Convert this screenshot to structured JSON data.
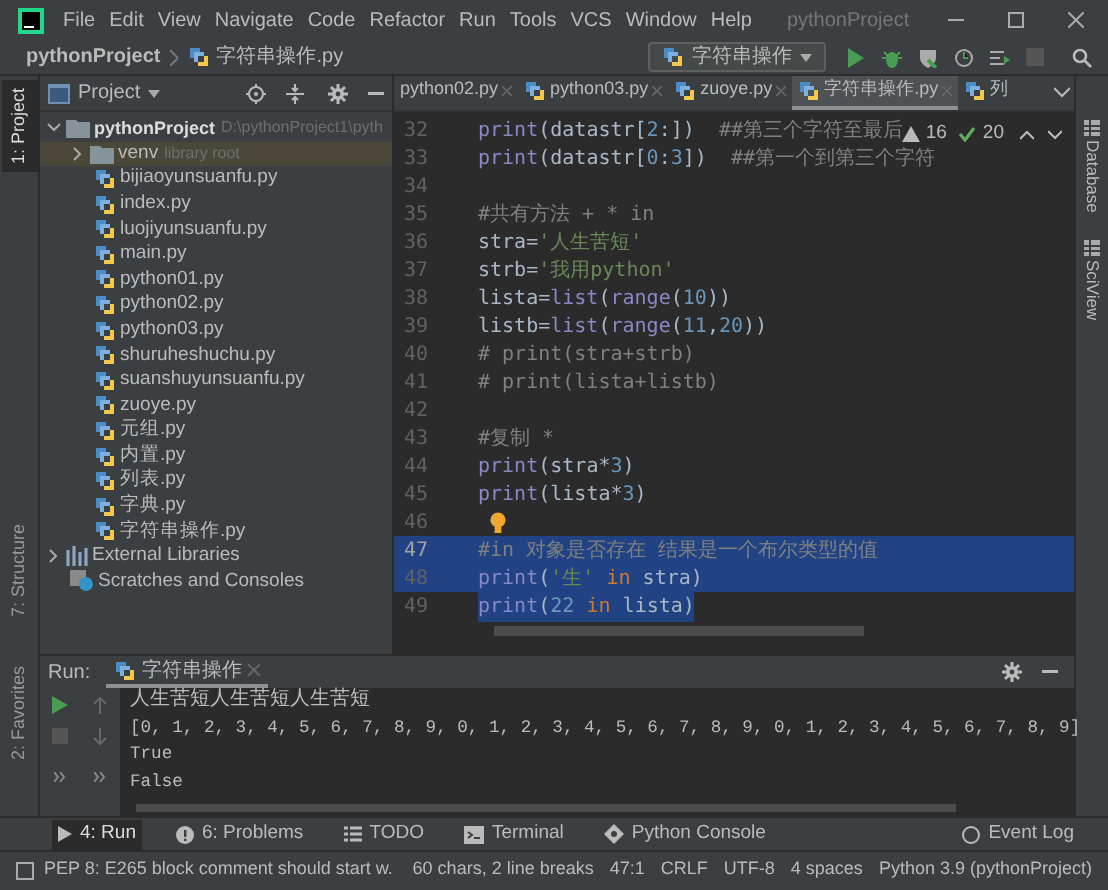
{
  "window": {
    "title": "pythonProject",
    "menu": [
      "File",
      "Edit",
      "View",
      "Navigate",
      "Code",
      "Refactor",
      "Run",
      "Tools",
      "VCS",
      "Window",
      "Help"
    ]
  },
  "breadcrumb": [
    "pythonProject",
    "字符串操作.py"
  ],
  "run_config": {
    "label": "字符串操作"
  },
  "left_stripe": [
    {
      "label": "1: Project",
      "selected": true
    },
    {
      "label": "7: Structure",
      "selected": false
    },
    {
      "label": "2: Favorites",
      "selected": false
    }
  ],
  "right_stripe": [
    "Database",
    "SciView"
  ],
  "project_panel": {
    "title": "Project",
    "tree": [
      {
        "label": "pythonProject",
        "path": "D:\\pythonProject1\\pyth",
        "kind": "folder",
        "expanded": true,
        "selected": false,
        "children": [
          {
            "label": "venv",
            "path": "library root",
            "kind": "folder",
            "expanded": false,
            "selected": true
          },
          {
            "label": "bijiaoyunsuanfu.py",
            "kind": "file",
            "selected": false
          },
          {
            "label": "index.py",
            "kind": "file",
            "selected": false
          },
          {
            "label": "luojiyunsuanfu.py",
            "kind": "file",
            "selected": false
          },
          {
            "label": "main.py",
            "kind": "file",
            "selected": false
          },
          {
            "label": "python01.py",
            "kind": "file",
            "selected": false
          },
          {
            "label": "python02.py",
            "kind": "file",
            "selected": false
          },
          {
            "label": "python03.py",
            "kind": "file",
            "selected": false
          },
          {
            "label": "shuruheshuchu.py",
            "kind": "file",
            "selected": false
          },
          {
            "label": "suanshuyunsuanfu.py",
            "kind": "file",
            "selected": false
          },
          {
            "label": "zuoye.py",
            "kind": "file",
            "selected": false
          },
          {
            "label": "元组.py",
            "kind": "file",
            "selected": false
          },
          {
            "label": "内置.py",
            "kind": "file",
            "selected": false
          },
          {
            "label": "列表.py",
            "kind": "file",
            "selected": false
          },
          {
            "label": "字典.py",
            "kind": "file",
            "selected": false
          },
          {
            "label": "字符串操作.py",
            "kind": "file",
            "selected": false
          }
        ]
      },
      {
        "label": "External Libraries",
        "kind": "libraries",
        "expanded": false,
        "selected": false
      },
      {
        "label": "Scratches and Consoles",
        "kind": "scratches",
        "selected": false
      }
    ]
  },
  "editor_tabs": [
    {
      "label": "python02.py",
      "selected": false,
      "icon": false
    },
    {
      "label": "python03.py",
      "selected": false,
      "icon": true
    },
    {
      "label": "zuoye.py",
      "selected": false,
      "icon": true
    },
    {
      "label": "字符串操作.py",
      "selected": true,
      "icon": true
    },
    {
      "label": "列",
      "selected": false,
      "icon": true
    }
  ],
  "inspections": {
    "warnings": "16",
    "ok": "20"
  },
  "editor_lines": [
    {
      "number": "32",
      "selected": false,
      "current": false,
      "tokens": [
        {
          "kind": "builtin",
          "text": "print"
        },
        {
          "kind": "plain",
          "text": "(datastr["
        },
        {
          "kind": "number",
          "text": "2"
        },
        {
          "kind": "plain",
          "text": ":])"
        },
        {
          "kind": "comment",
          "text": "##第三个字符至最后"
        }
      ]
    },
    {
      "number": "33",
      "selected": false,
      "current": false,
      "tokens": [
        {
          "kind": "builtin",
          "text": "print"
        },
        {
          "kind": "plain",
          "text": "(datastr["
        },
        {
          "kind": "number",
          "text": "0"
        },
        {
          "kind": "plain",
          "text": ":"
        },
        {
          "kind": "number",
          "text": "3"
        },
        {
          "kind": "plain",
          "text": "])"
        },
        {
          "kind": "comment",
          "text": "##第一个到第三个字符"
        }
      ]
    },
    {
      "number": "34",
      "selected": false,
      "current": false
    },
    {
      "number": "35",
      "selected": false,
      "current": false,
      "tokens": [
        {
          "kind": "comment",
          "text": "#共有方法 + * in"
        }
      ]
    },
    {
      "number": "36",
      "selected": false,
      "current": false,
      "tokens": [
        {
          "kind": "plain",
          "text": "stra="
        },
        {
          "kind": "string",
          "text": "'人生苦短'"
        }
      ]
    },
    {
      "number": "37",
      "selected": false,
      "current": false,
      "tokens": [
        {
          "kind": "plain",
          "text": "strb="
        },
        {
          "kind": "string",
          "text": "'我用python'"
        }
      ]
    },
    {
      "number": "38",
      "selected": false,
      "current": false,
      "tokens": [
        {
          "kind": "plain",
          "text": "lista="
        },
        {
          "kind": "builtin",
          "text": "list"
        },
        {
          "kind": "plain",
          "text": "("
        },
        {
          "kind": "builtin",
          "text": "range"
        },
        {
          "kind": "plain",
          "text": "("
        },
        {
          "kind": "number",
          "text": "10"
        },
        {
          "kind": "plain",
          "text": "))"
        }
      ]
    },
    {
      "number": "39",
      "selected": false,
      "current": false,
      "tokens": [
        {
          "kind": "plain",
          "text": "listb="
        },
        {
          "kind": "builtin",
          "text": "list"
        },
        {
          "kind": "plain",
          "text": "("
        },
        {
          "kind": "builtin",
          "text": "range"
        },
        {
          "kind": "plain",
          "text": "("
        },
        {
          "kind": "number",
          "text": "11"
        },
        {
          "kind": "plain",
          "text": ","
        },
        {
          "kind": "number",
          "text": "20"
        },
        {
          "kind": "plain",
          "text": "))"
        }
      ]
    },
    {
      "number": "40",
      "selected": false,
      "current": false,
      "tokens": [
        {
          "kind": "comment",
          "text": "# print(stra+strb)"
        }
      ]
    },
    {
      "number": "41",
      "selected": false,
      "current": false,
      "tokens": [
        {
          "kind": "comment",
          "text": "# print(lista+listb)"
        }
      ]
    },
    {
      "number": "42",
      "selected": false,
      "current": false
    },
    {
      "number": "43",
      "selected": false,
      "current": false,
      "tokens": [
        {
          "kind": "comment",
          "text": "#复制 *"
        }
      ]
    },
    {
      "number": "44",
      "selected": false,
      "current": false,
      "tokens": [
        {
          "kind": "builtin",
          "text": "print"
        },
        {
          "kind": "plain",
          "text": "(stra*"
        },
        {
          "kind": "number",
          "text": "3"
        },
        {
          "kind": "plain",
          "text": ")"
        }
      ]
    },
    {
      "number": "45",
      "selected": false,
      "current": false,
      "tokens": [
        {
          "kind": "builtin",
          "text": "print"
        },
        {
          "kind": "plain",
          "text": "(lista*"
        },
        {
          "kind": "number",
          "text": "3"
        },
        {
          "kind": "plain",
          "text": ")"
        }
      ]
    },
    {
      "number": "46",
      "selected": false,
      "current": false,
      "bulb": true
    },
    {
      "number": "47",
      "selected": true,
      "current": true,
      "tokens": [
        {
          "kind": "comment",
          "text": "#in 对象是否存在 结果是一个布尔类型的值"
        }
      ]
    },
    {
      "number": "48",
      "selected": true,
      "current": false,
      "tokens": [
        {
          "kind": "builtin",
          "text": "print"
        },
        {
          "kind": "plain",
          "text": "("
        },
        {
          "kind": "string",
          "text": "'生'"
        },
        {
          "kind": "keyword",
          "text": "in"
        },
        {
          "kind": "plain",
          "text": "stra)"
        }
      ]
    },
    {
      "number": "49",
      "selected": true,
      "current": false,
      "tokens": [
        {
          "kind": "builtin",
          "text": "print"
        },
        {
          "kind": "plain",
          "text": "("
        },
        {
          "kind": "number",
          "text": "22"
        },
        {
          "kind": "keyword",
          "text": "in"
        },
        {
          "kind": "plain",
          "text": "lista)"
        }
      ]
    }
  ],
  "run_panel": {
    "label": "Run:",
    "tab": "字符串操作",
    "output": [
      "人生苦短人生苦短人生苦短",
      "[0, 1, 2, 3, 4, 5, 6, 7, 8, 9, 0, 1, 2, 3, 4, 5, 6, 7, 8, 9, 0, 1, 2, 3, 4, 5, 6, 7, 8, 9]",
      "True",
      "False"
    ]
  },
  "tool_tabs": [
    {
      "label": "4: Run",
      "kind": "run",
      "selected": true
    },
    {
      "label": "6: Problems",
      "kind": "problems",
      "selected": false
    },
    {
      "label": "TODO",
      "kind": "todo",
      "selected": false
    },
    {
      "label": "Terminal",
      "kind": "terminal",
      "selected": false
    },
    {
      "label": "Python Console",
      "kind": "console",
      "selected": false
    },
    {
      "label": "Event Log",
      "kind": "log",
      "selected": false
    }
  ],
  "status_bar": {
    "message": "PEP 8: E265 block comment should start w.",
    "items": [
      "60 chars, 2 line breaks",
      "47:1",
      "CRLF",
      "UTF-8",
      "4 spaces",
      "Python 3.9 (pythonProject)"
    ]
  }
}
